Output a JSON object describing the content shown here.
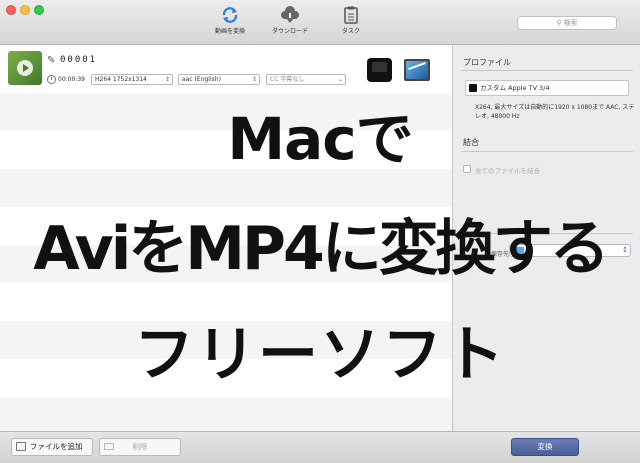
{
  "toolbar": {
    "convert_label": "動画を変換",
    "download_label": "ダウンロード",
    "task_label": "タスク",
    "search_placeholder": "検索"
  },
  "item": {
    "name": "00001",
    "duration": "00:00:39",
    "video": "H264 1752x1314",
    "audio": "aac (English)",
    "subtitle": "CC 字幕なし",
    "device": "tv"
  },
  "panel": {
    "profile_title": "プロファイル",
    "profile_value": "カスタム Apple TV 3/4",
    "profile_desc": "X264, 最大サイズは自動的に1920 x 1080まで AAC, ステレオ, 48000 Hz",
    "merge_title": "結合",
    "merge_option": "全てのファイルを結合",
    "dest_label": "保存先:"
  },
  "bottom": {
    "add_label": "ファイルを追加",
    "delete_label": "削除",
    "convert_label": "変換"
  },
  "overlay": {
    "line1": "Macで",
    "line2": "AviをMP4に変換する",
    "line3": "フリーソフト"
  }
}
